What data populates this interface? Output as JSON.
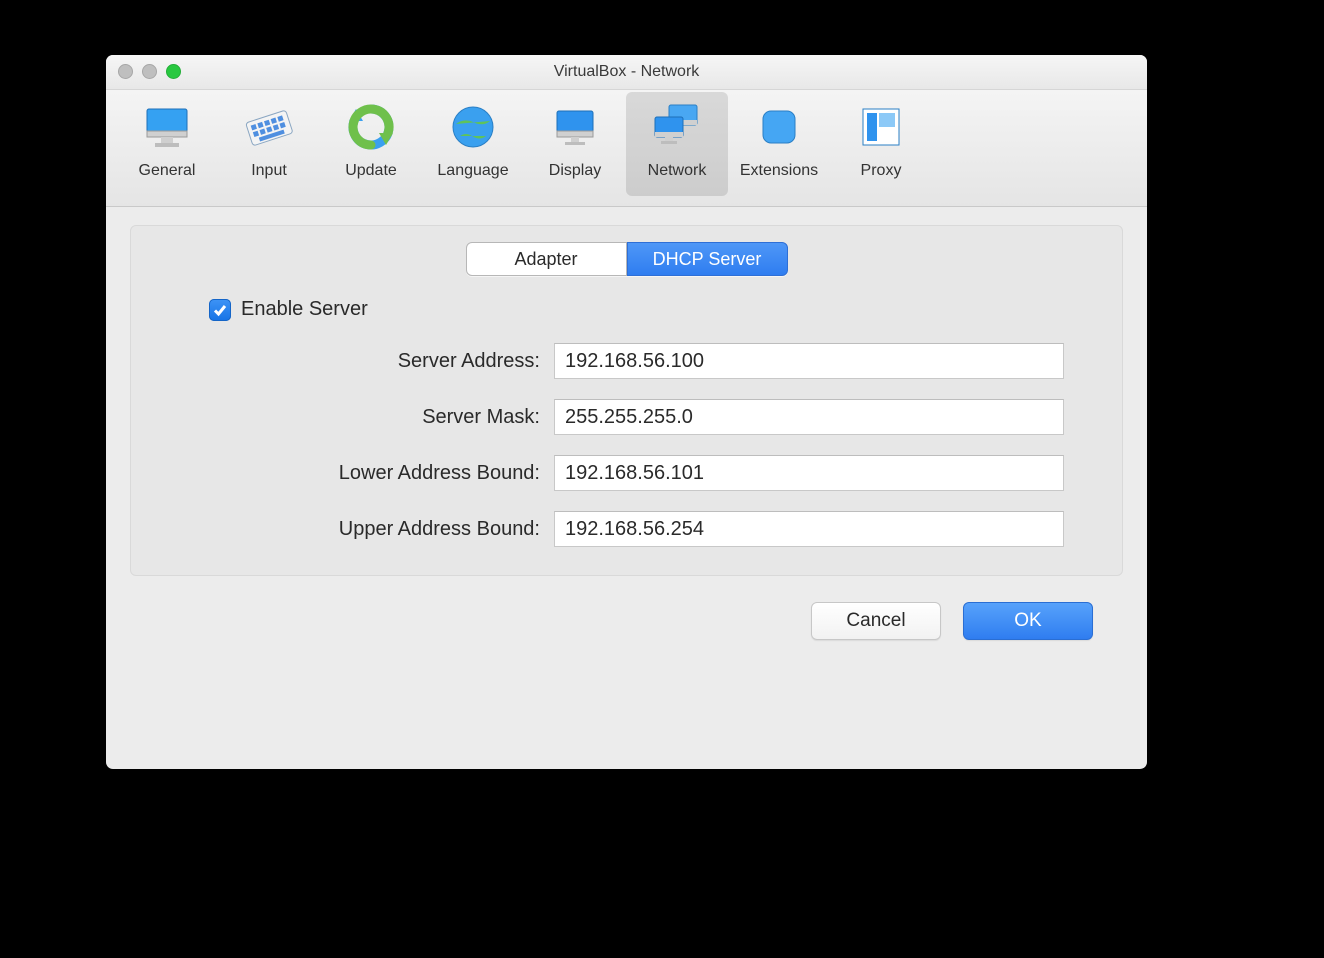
{
  "window": {
    "title": "VirtualBox - Network"
  },
  "toolbar": {
    "items": [
      {
        "label": "General"
      },
      {
        "label": "Input"
      },
      {
        "label": "Update"
      },
      {
        "label": "Language"
      },
      {
        "label": "Display"
      },
      {
        "label": "Network"
      },
      {
        "label": "Extensions"
      },
      {
        "label": "Proxy"
      }
    ],
    "active_index": 5
  },
  "tabs": {
    "items": [
      {
        "label": "Adapter"
      },
      {
        "label": "DHCP Server"
      }
    ],
    "selected_index": 1
  },
  "dhcp": {
    "enable_label": "Enable Server",
    "enable_checked": true,
    "server_address_label": "Server Address:",
    "server_address_value": "192.168.56.100",
    "server_mask_label": "Server Mask:",
    "server_mask_value": "255.255.255.0",
    "lower_bound_label": "Lower Address Bound:",
    "lower_bound_value": "192.168.56.101",
    "upper_bound_label": "Upper Address Bound:",
    "upper_bound_value": "192.168.56.254"
  },
  "footer": {
    "cancel_label": "Cancel",
    "ok_label": "OK"
  },
  "colors": {
    "accent": "#2f7df0"
  }
}
